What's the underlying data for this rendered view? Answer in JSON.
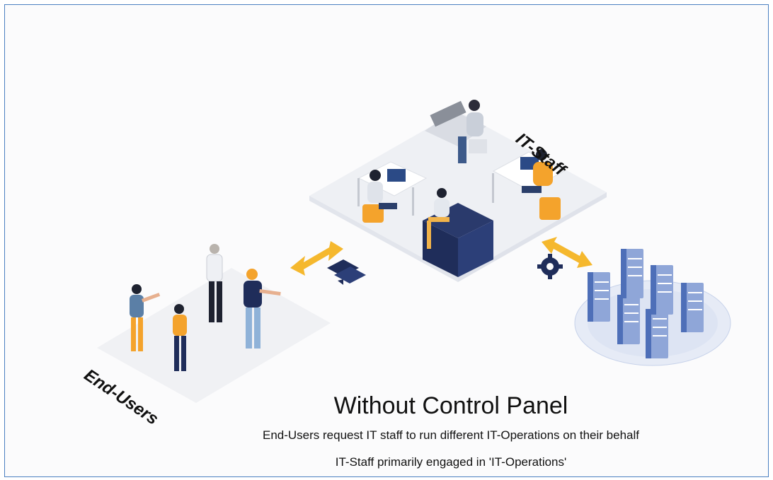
{
  "labels": {
    "it_staff": "IT-Staff",
    "end_users": "End-Users"
  },
  "title": "Without Control Panel",
  "subtitle_lines": [
    "End-Users request IT staff to run different IT-Operations on their behalf",
    "IT-Staff primarily engaged in 'IT-Operations'"
  ],
  "icons": [
    "double-arrow-icon",
    "chat-bubbles-icon",
    "gear-icon",
    "server-rack-icon"
  ],
  "colors": {
    "border": "#4a7fc1",
    "arrow": "#f5b82e",
    "navy": "#1f2d5a",
    "server": "#8fa6d8",
    "platform": "#eef0f4"
  }
}
